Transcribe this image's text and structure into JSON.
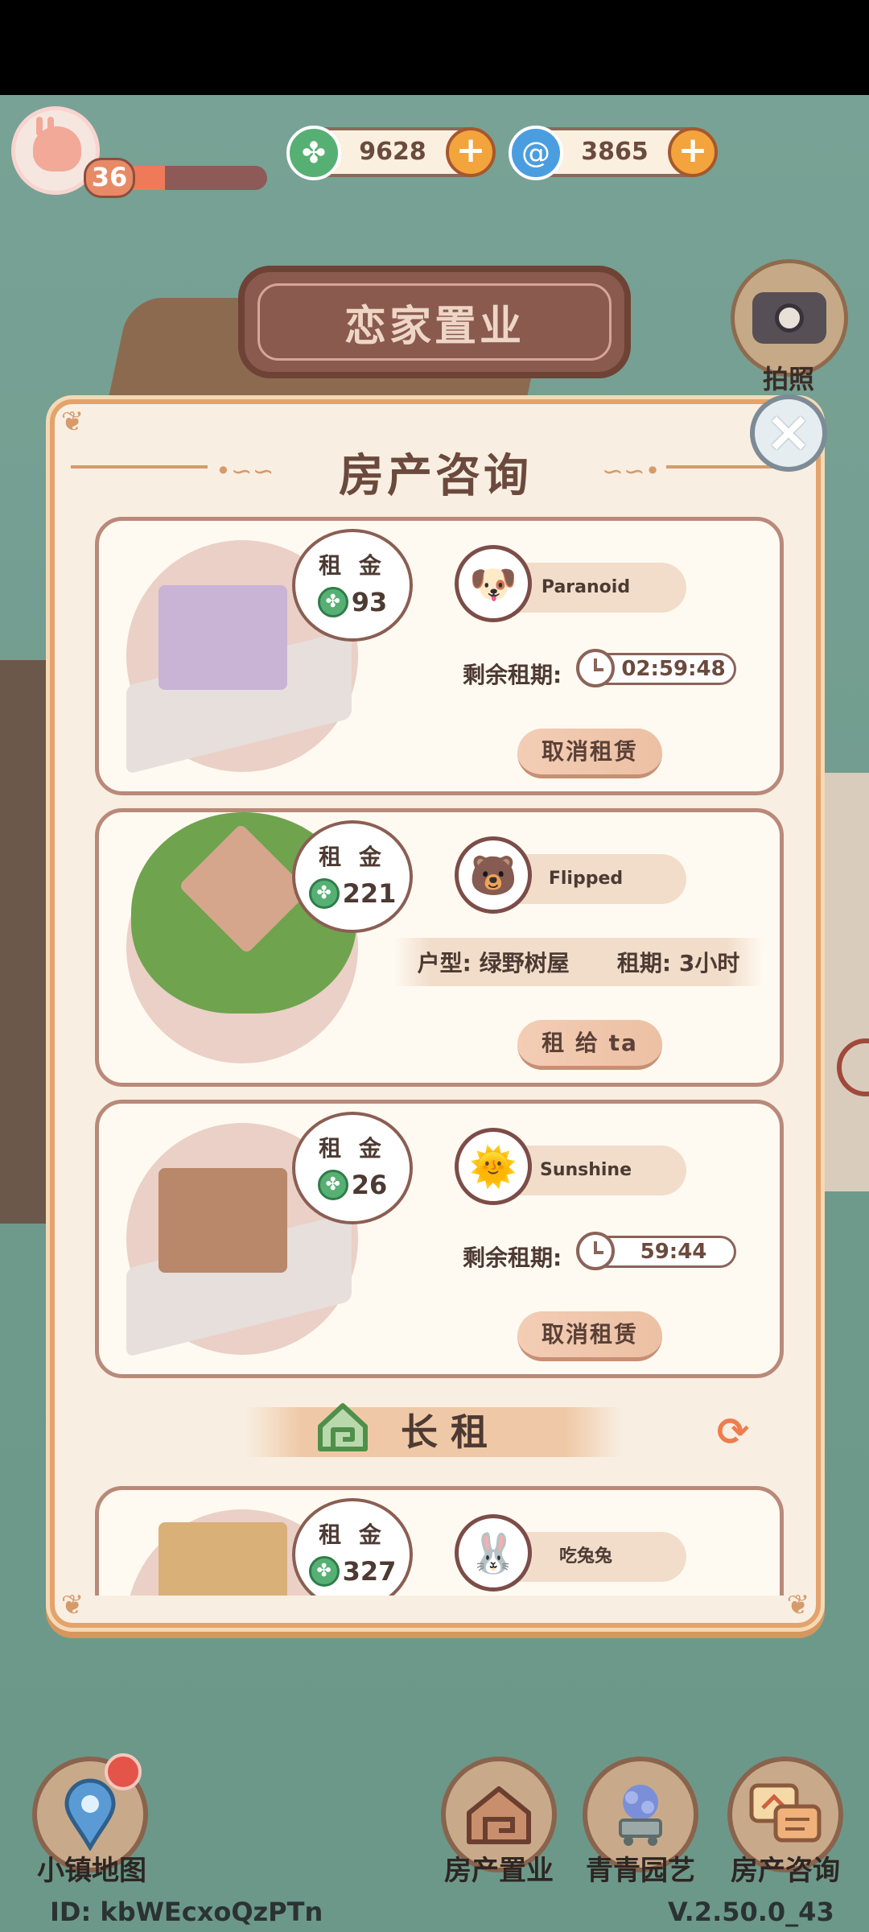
{
  "player": {
    "level": "36",
    "xp_fraction": 0.3
  },
  "currency": {
    "clover": "9628",
    "swirl": "3865",
    "add_symbol": "+"
  },
  "header": {
    "sign_title": "恋家置业",
    "camera_label": "拍照"
  },
  "panel": {
    "title": "房产咨询",
    "close_symbol": "×"
  },
  "rent_label": "租 金",
  "listings": [
    {
      "rent": "93",
      "user": "Paranoid",
      "lease_label": "剩余租期:",
      "timer": "02:59:48",
      "action": "取消租赁"
    },
    {
      "rent": "221",
      "user": "Flipped",
      "type_text": "户型: 绿野树屋",
      "term_text": "租期: 3小时",
      "action": "租 给 ta"
    },
    {
      "rent": "26",
      "user": "Sunshine",
      "lease_label": "剩余租期:",
      "timer": "59:44",
      "action": "取消租赁"
    }
  ],
  "section": {
    "title": "长租",
    "refresh_icon": "refresh-icon"
  },
  "long_term_listing": {
    "rent": "327",
    "user": "吃兔兔"
  },
  "bottom_nav": {
    "map": "小镇地图",
    "property": "房产置业",
    "garden": "青青园艺",
    "consult": "房产咨询"
  },
  "footer": {
    "id_text": "ID: kbWEcxoQzPTn",
    "version": "V.2.50.0_43"
  },
  "colors": {
    "background": "#6f9a8d",
    "panel": "#f8efe2",
    "panel_border": "#e3a36b",
    "accent_orange": "#f3a43c",
    "clover_green": "#57b073",
    "swirl_blue": "#4a9ee0"
  }
}
